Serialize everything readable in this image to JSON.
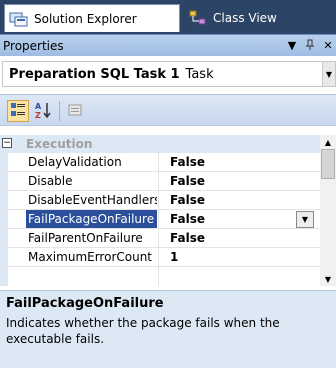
{
  "tabs": [
    {
      "label": "Solution Explorer",
      "icon": "solution-explorer-icon",
      "active": true
    },
    {
      "label": "Class View",
      "icon": "class-view-icon",
      "active": false
    }
  ],
  "properties_panel": {
    "title": "Properties",
    "header_buttons": {
      "dropdown": "▼",
      "pin": "ᵖ",
      "close": "✕"
    },
    "object_selector": {
      "name": "Preparation SQL Task 1",
      "type": "Task"
    },
    "toolbar": [
      {
        "name": "categorized-button",
        "icon": "categorized-icon",
        "pressed": true
      },
      {
        "name": "alphabetical-button",
        "icon": "sort-az-icon",
        "pressed": false
      },
      {
        "name": "property-pages-button",
        "icon": "property-pages-icon",
        "pressed": false
      }
    ],
    "category": {
      "toggle": "−",
      "label": "Execution"
    },
    "rows": [
      {
        "name": "DelayValidation",
        "value": "False"
      },
      {
        "name": "Disable",
        "value": "False"
      },
      {
        "name": "DisableEventHandlers",
        "value": "False"
      },
      {
        "name": "FailPackageOnFailure",
        "value": "False"
      },
      {
        "name": "FailParentOnFailure",
        "value": "False"
      },
      {
        "name": "MaximumErrorCount",
        "value": "1"
      }
    ],
    "selected_row": "FailPackageOnFailure",
    "description": {
      "title": "FailPackageOnFailure",
      "text": "Indicates whether the package fails when the executable fails."
    }
  },
  "colors": {
    "tab_strip": "#2c4566",
    "header": "#b8d0ec",
    "selection": "#2b4f9a",
    "panel_bg": "#dde8f5"
  }
}
